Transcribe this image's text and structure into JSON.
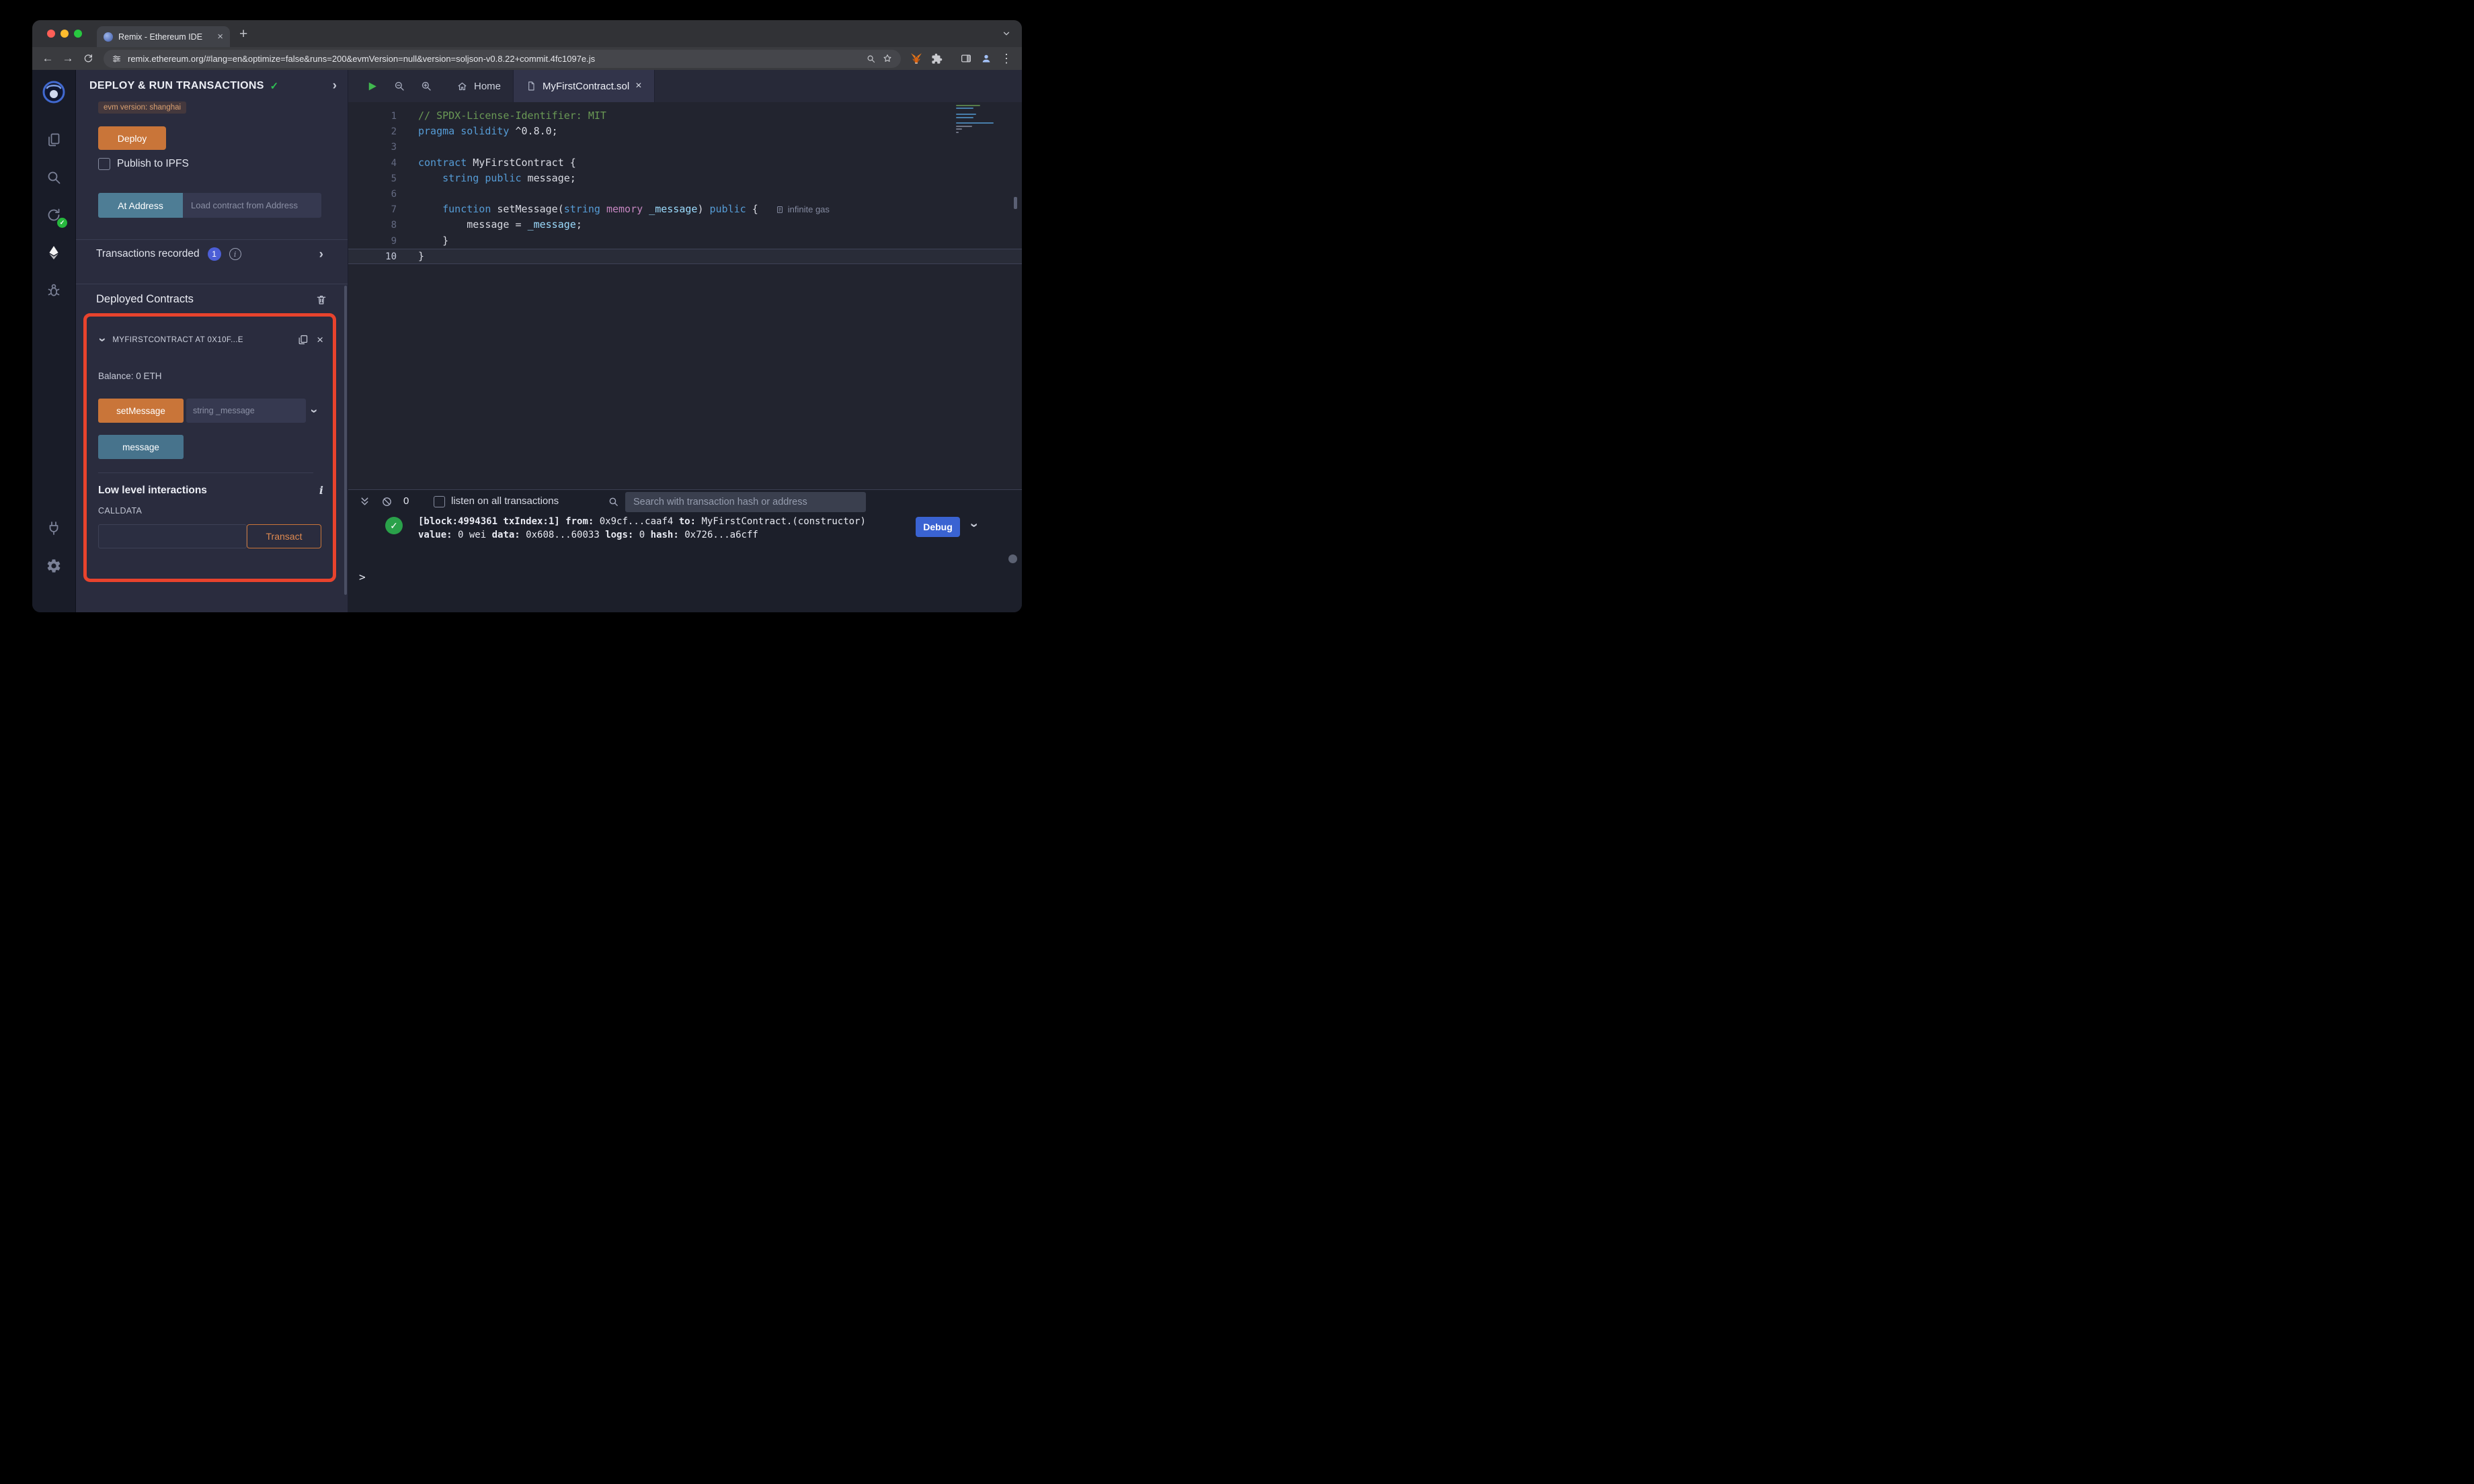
{
  "glyphs": {
    "back": "←",
    "forward": "→",
    "plus": "+",
    "close": "×",
    "kebab": "⋮",
    "check": "✓",
    "chevron": "›",
    "info": "i"
  },
  "browser": {
    "tab_title": "Remix - Ethereum IDE",
    "url": "remix.ethereum.org/#lang=en&optimize=false&runs=200&evmVersion=null&version=soljson-v0.8.22+commit.4fc1097e.js"
  },
  "deploy_panel": {
    "title": "DEPLOY & RUN TRANSACTIONS",
    "evm_version_badge": "evm version: shanghai",
    "deploy_button": "Deploy",
    "publish_label": "Publish to IPFS",
    "at_address_button": "At Address",
    "at_address_placeholder": "Load contract from Address",
    "transactions_recorded_label": "Transactions recorded",
    "transactions_recorded_count": "1",
    "deployed_contracts_header": "Deployed Contracts",
    "contract": {
      "title": "MYFIRSTCONTRACT AT 0X10F...E",
      "balance": "Balance: 0 ETH",
      "set_message_button": "setMessage",
      "set_message_placeholder": "string _message",
      "message_button": "message",
      "low_level_label": "Low level interactions",
      "calldata_label": "CALLDATA",
      "transact_button": "Transact"
    }
  },
  "editor": {
    "home_tab": "Home",
    "file_tab": "MyFirstContract.sol",
    "gas_annotation": "infinite gas",
    "code_lines": [
      {
        "n": "1",
        "tokens": [
          [
            "cm",
            "// SPDX-License-Identifier: MIT"
          ]
        ]
      },
      {
        "n": "2",
        "tokens": [
          [
            "kw",
            "pragma"
          ],
          [
            "pl",
            " "
          ],
          [
            "kw",
            "solidity"
          ],
          [
            "pl",
            " ^0.8.0;"
          ]
        ]
      },
      {
        "n": "3",
        "tokens": []
      },
      {
        "n": "4",
        "tokens": [
          [
            "kw",
            "contract"
          ],
          [
            "pl",
            " MyFirstContract {"
          ]
        ]
      },
      {
        "n": "5",
        "tokens": [
          [
            "pl",
            "    "
          ],
          [
            "kw",
            "string"
          ],
          [
            "pl",
            " "
          ],
          [
            "kw",
            "public"
          ],
          [
            "pl",
            " message;"
          ]
        ]
      },
      {
        "n": "6",
        "tokens": []
      },
      {
        "n": "7",
        "gas": true,
        "tokens": [
          [
            "pl",
            "    "
          ],
          [
            "kw",
            "function"
          ],
          [
            "pl",
            " setMessage("
          ],
          [
            "kw",
            "string"
          ],
          [
            "pl",
            " "
          ],
          [
            "kw2",
            "memory"
          ],
          [
            "pl",
            " "
          ],
          [
            "pm",
            "_message"
          ],
          [
            "pl",
            ") "
          ],
          [
            "kw",
            "public"
          ],
          [
            "pl",
            " {"
          ]
        ]
      },
      {
        "n": "8",
        "tokens": [
          [
            "pl",
            "        message = "
          ],
          [
            "pm",
            "_message"
          ],
          [
            "pl",
            ";"
          ]
        ]
      },
      {
        "n": "9",
        "tokens": [
          [
            "pl",
            "    }"
          ]
        ]
      },
      {
        "n": "10",
        "current": true,
        "tokens": [
          [
            "pl",
            "}"
          ]
        ]
      }
    ]
  },
  "terminal": {
    "count": "0",
    "listen_label": "listen on all transactions",
    "search_placeholder": "Search with transaction hash or address",
    "debug_button": "Debug",
    "prompt": ">",
    "log": {
      "line1": [
        {
          "b": true,
          "t": "[block:4994361 txIndex:1] "
        },
        {
          "b": true,
          "t": "from:"
        },
        {
          "b": false,
          "t": " 0x9cf...caaf4 "
        },
        {
          "b": true,
          "t": "to:"
        },
        {
          "b": false,
          "t": " MyFirstContract.(constructor)"
        }
      ],
      "line2": [
        {
          "b": true,
          "t": "value:"
        },
        {
          "b": false,
          "t": " 0 wei "
        },
        {
          "b": true,
          "t": "data:"
        },
        {
          "b": false,
          "t": " 0x608...60033 "
        },
        {
          "b": true,
          "t": "logs:"
        },
        {
          "b": false,
          "t": " 0 "
        },
        {
          "b": true,
          "t": "hash:"
        },
        {
          "b": false,
          "t": " 0x726...a6cff"
        }
      ]
    }
  },
  "colors": {
    "accent_orange": "#c97539",
    "accent_steel_blue": "#4e7d95",
    "annotation_red": "#e8432d",
    "debug_blue": "#3a63d2",
    "success_green": "#2aa14a"
  }
}
